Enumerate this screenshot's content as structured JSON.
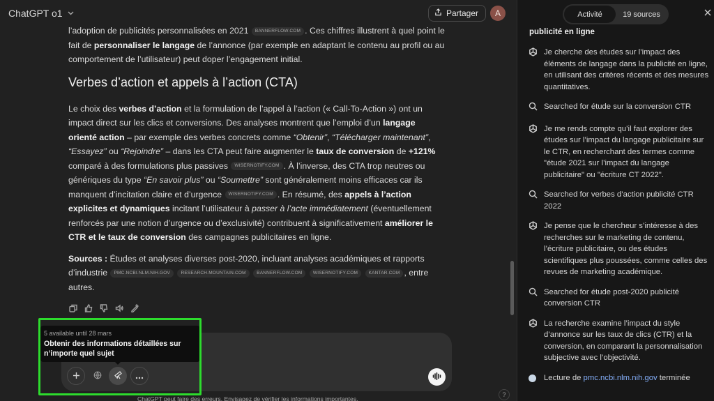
{
  "topbar": {
    "model_name": "ChatGPT o1",
    "share_label": "Partager",
    "avatar_initial": "A"
  },
  "article": {
    "p1": {
      "a": "l’adoption de publicités personnalisées en 2021",
      "tag": "BANNERFLOW.COM",
      "b": ". Ces chiffres illustrent à quel point le fait de",
      "bold": "personnaliser le langage",
      "c": "de l’annonce (par exemple en adaptant le contenu au profil ou au comportement de l’utilisateur) peut doper l’engagement initial."
    },
    "heading": "Verbes d’action et appels à l’action (CTA)",
    "p2": {
      "s1": "Le choix des",
      "b1": "verbes d’action",
      "s2": "et la formulation de l’appel à l’action (« Call-To-Action ») ont un impact direct sur les clics et conversions. Des analyses montrent que l’emploi d’un",
      "b2": "langage orienté action",
      "s3": "– par exemple des verbes concrets comme",
      "i1": "“Obtenir”",
      "s4": ",",
      "i2": "“Télécharger maintenant”",
      "s5": ",",
      "i3": "“Essayez”",
      "s6": "ou",
      "i4": "“Rejoindre”",
      "s7": "– dans les CTA peut faire augmenter le",
      "b3": "taux de conversion",
      "s8": "de",
      "b4": "+121%",
      "s9": "comparé à des formulations plus passives",
      "tag1": "WISERNOTIFY.COM",
      "s10": ". À l’inverse, des CTA trop neutres ou génériques du type",
      "i5": "“En savoir plus”",
      "s11": "ou",
      "i6": "“Soumettre”",
      "s12": "sont généralement moins efficaces car ils manquent d’incitation claire et d’urgence",
      "tag2": "WISERNOTIFY.COM",
      "s13": ". En résumé, des",
      "b5": "appels à l’action explicites et dynamiques",
      "s14": "incitant l’utilisateur à",
      "i7": "passer à l’acte immédiatement",
      "s15": "(éventuellement renforcés par une notion d’urgence ou d’exclusivité) contribuent à significativement",
      "b6": "améliorer le CTR et le taux de conversion",
      "s16": "des campagnes publicitaires en ligne."
    },
    "sources": {
      "label": "Sources :",
      "text": "Études et analyses diverses post-2020, incluant analyses académiques et rapports d’industrie",
      "tags": [
        "PMC.NCBI.NLM.NIH.GOV",
        "RESEARCH.MOUNTAIN.COM",
        "BANNERFLOW.COM",
        "WISERNOTIFY.COM",
        "KANTAR.COM"
      ],
      "tail": ", entre autres."
    }
  },
  "composer": {
    "tooltip_line1": "5 available until 28 mars",
    "tooltip_line2": "Obtenir des informations détaillées sur n’importe quel sujet",
    "disclaimer": "ChatGPT peut faire des erreurs. Envisagez de vérifier les informations importantes.",
    "help": "?"
  },
  "panel": {
    "tab_activity": "Activité",
    "tab_sources": "19 sources",
    "heading": "publicité en ligne",
    "activities": [
      {
        "icon": "reasoning-icon",
        "text": "Je cherche des études sur l’impact des éléments de langage dans la publicité en ligne, en utilisant des critères récents et des mesures quantitatives."
      },
      {
        "icon": "search-icon",
        "text": "Searched for étude sur la conversion CTR"
      },
      {
        "icon": "reasoning-icon",
        "text": "Je me rends compte qu’il faut explorer des études sur l’impact du langage publicitaire sur le CTR, en recherchant des termes comme \"étude 2021 sur l’impact du langage publicitaire\" ou \"écriture CT 2022\"."
      },
      {
        "icon": "search-icon",
        "text": "Searched for verbes d’action publicité CTR 2022"
      },
      {
        "icon": "reasoning-icon",
        "text": "Je pense que le chercheur s’intéresse à des recherches sur le marketing de contenu, l’écriture publicitaire, ou des études scientifiques plus poussées, comme celles des revues de marketing académique."
      },
      {
        "icon": "search-icon",
        "text": "Searched for étude post-2020 publicité conversion CTR"
      },
      {
        "icon": "reasoning-icon",
        "text": "La recherche examine l’impact du style d’annonce sur les taux de clics (CTR) et la conversion, en comparant la personnalisation subjective avec l’objectivité."
      }
    ],
    "reading": {
      "prefix": "Lecture de",
      "link": "pmc.ncbi.nlm.nih.gov",
      "suffix": "terminée"
    }
  }
}
